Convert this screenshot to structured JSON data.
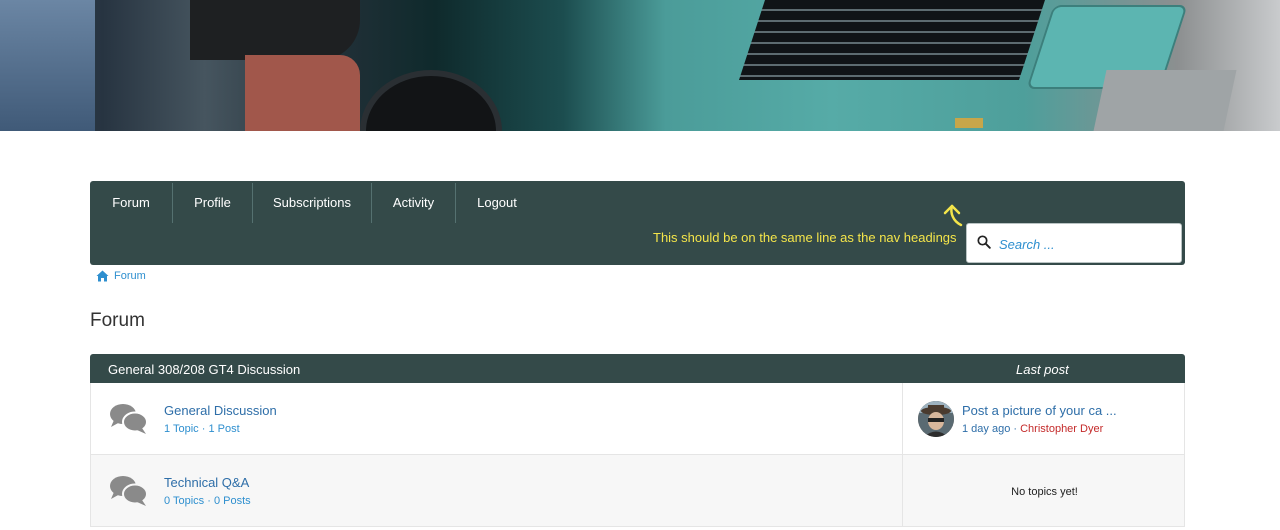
{
  "nav": {
    "items": [
      "Forum",
      "Profile",
      "Subscriptions",
      "Activity",
      "Logout"
    ],
    "annotation": "This should be on the same line as the nav headings",
    "search_placeholder": "Search ..."
  },
  "breadcrumb": {
    "label": "Forum"
  },
  "page_title": "Forum",
  "table": {
    "category": "General 308/208 GT4 Discussion",
    "last_post_header": "Last post",
    "rows": [
      {
        "name": "General Discussion",
        "topics": "1 Topic",
        "posts": "1 Post",
        "last_post_title": "Post a picture of your ca ...",
        "last_post_time": "1 day ago",
        "last_post_author": "Christopher Dyer"
      },
      {
        "name": "Technical Q&A",
        "topics": "0 Topics",
        "posts": "0 Posts",
        "no_topics": "No topics yet!"
      }
    ]
  },
  "colors": {
    "nav_bg": "#344a49",
    "link": "#2e6ea8",
    "annotation": "#f4e54a",
    "author": "#c42a2a"
  }
}
